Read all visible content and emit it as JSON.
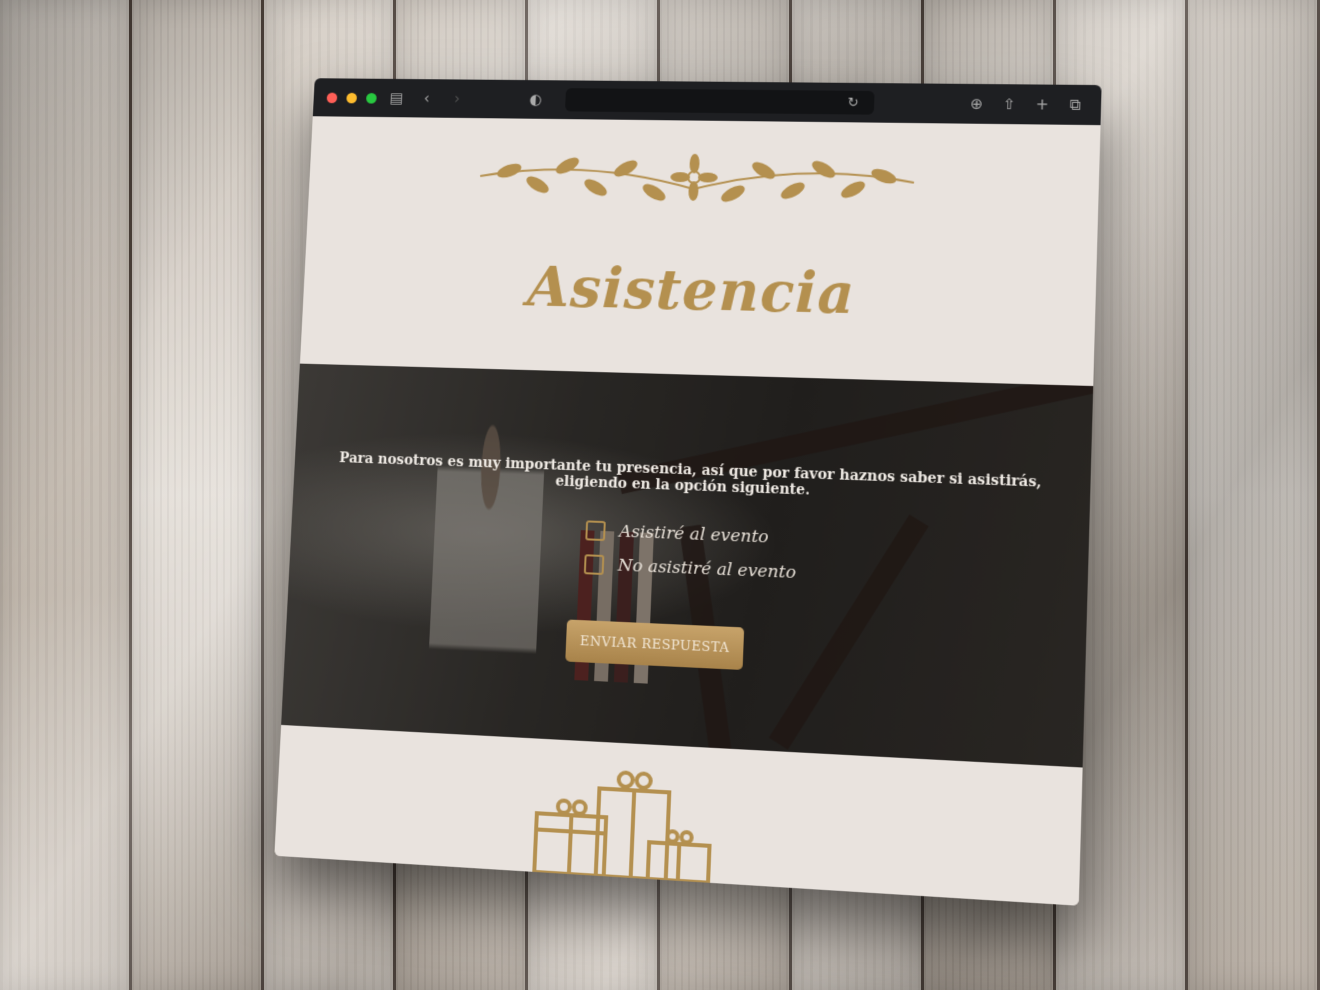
{
  "browser": {
    "toolbar_icons": [
      "sidebar-icon",
      "back-icon",
      "forward-icon",
      "shield-icon",
      "reload-icon",
      "download-icon",
      "share-icon",
      "new-tab-icon",
      "tabs-icon"
    ]
  },
  "section": {
    "title": "Asistencia",
    "message": "Para nosotros es muy importante tu presencia, así que por favor haznos saber si asistirás, eligiendo en la opción siguiente.",
    "options": [
      {
        "label": "Asistiré al evento",
        "checked": false
      },
      {
        "label": "No asistiré al evento",
        "checked": false
      }
    ],
    "submit_label": "ENVIAR RESPUESTA"
  },
  "colors": {
    "accent_gold": "#b4904f",
    "background": "#e9e3de",
    "toolbar": "#1e1f22"
  }
}
